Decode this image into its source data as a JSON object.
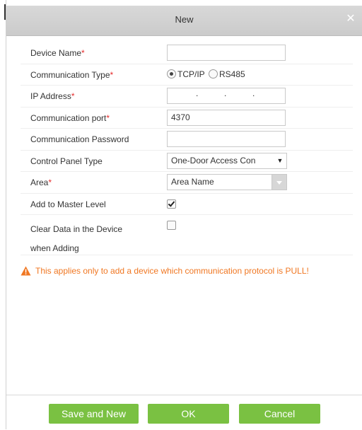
{
  "dialog": {
    "title": "New"
  },
  "form": {
    "device_name": {
      "label": "Device Name",
      "required": "*",
      "value": ""
    },
    "communication_type": {
      "label": "Communication Type",
      "required": "*",
      "options": [
        {
          "label": "TCP/IP",
          "checked": true
        },
        {
          "label": "RS485",
          "checked": false
        }
      ]
    },
    "ip_address": {
      "label": "IP Address",
      "required": "*",
      "separators": [
        ".",
        ".",
        "."
      ]
    },
    "communication_port": {
      "label": "Communication port",
      "required": "*",
      "value": "4370"
    },
    "communication_password": {
      "label": "Communication Password",
      "value": ""
    },
    "control_panel_type": {
      "label": "Control Panel Type",
      "value": "One-Door Access Con"
    },
    "area": {
      "label": "Area",
      "required": "*",
      "value": "Area Name"
    },
    "add_to_master_level": {
      "label": "Add to Master Level",
      "checked": true
    },
    "clear_data": {
      "label_line1": "Clear Data in the Device",
      "label_line2": "when Adding",
      "checked": false
    }
  },
  "warning": {
    "text": "This applies only to add a device which communication protocol is PULL!",
    "color": "#f07722"
  },
  "buttons": {
    "save_new": "Save and New",
    "ok": "OK",
    "cancel": "Cancel",
    "color": "#7ac142"
  }
}
